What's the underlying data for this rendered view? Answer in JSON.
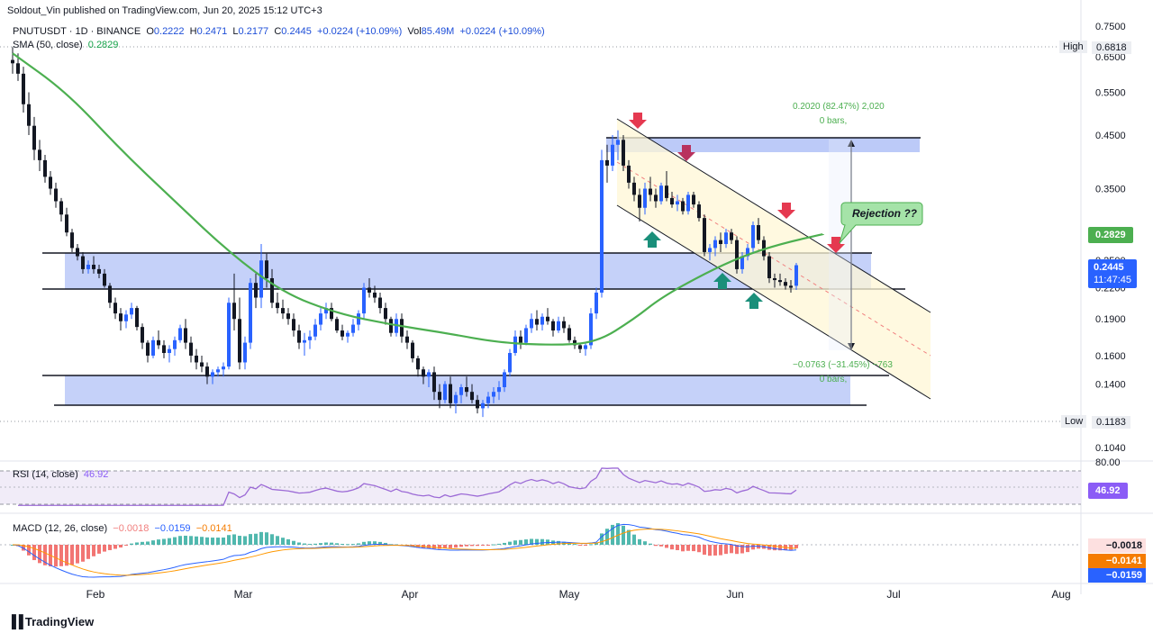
{
  "header": {
    "attribution": "Soldout_Vin published on TradingView.com, Jun 20, 2025 15:12 UTC+3"
  },
  "legend": {
    "symbol": "PNUTUSDT · 1D · BINANCE",
    "o_label": "O",
    "o": "0.2222",
    "h_label": "H",
    "h": "0.2471",
    "l_label": "L",
    "l": "0.2177",
    "c_label": "C",
    "c": "0.2445",
    "change": "+0.0224 (+10.09%)",
    "vol_label": "Vol",
    "vol": "85.49M",
    "vol_change": "+0.0224 (+10.09%)",
    "sma_label": "SMA (50, close)",
    "sma_value": "0.2829"
  },
  "price_axis": {
    "ticks": [
      "0.7500",
      "0.6500",
      "0.5500",
      "0.4500",
      "0.3500",
      "0.2800",
      "0.2500",
      "0.2200",
      "0.1900",
      "0.1600",
      "0.1400",
      "0.1040"
    ],
    "high_label": "High",
    "high_value": "0.6818",
    "low_label": "Low",
    "low_value": "0.1183",
    "sma_tag": "0.2829",
    "price_tag": "0.2445",
    "countdown": "11:47:45"
  },
  "time_axis": [
    "Feb",
    "Mar",
    "Apr",
    "May",
    "Jun",
    "Jul",
    "Aug"
  ],
  "annotations": {
    "rejection": "Rejection ??",
    "measure_up_line1": "0.2020 (82.47%) 2,020",
    "measure_up_line2": "0 bars,",
    "measure_down_line1": "−0.0763 (−31.45%) −763",
    "measure_down_line2": "0 bars,"
  },
  "rsi": {
    "label": "RSI (14, close)",
    "value": "46.92",
    "top_tick": "80.00",
    "tag": "46.92"
  },
  "macd": {
    "label": "MACD (12, 26, close)",
    "hist": "−0.0018",
    "macd": "−0.0159",
    "signal": "−0.0141",
    "tag_hist": "−0.0018",
    "tag_signal": "−0.0141",
    "tag_macd": "−0.0159"
  },
  "footer": {
    "brand": "TradingView"
  },
  "colors": {
    "up": "#2962ff",
    "down": "#131722",
    "sma": "#4caf50",
    "zone": "#9fb3f5",
    "rsi": "#9c6ad6",
    "macd_line": "#2962ff",
    "signal_line": "#ff9800",
    "hist_pos": "#26a69a",
    "hist_neg": "#ef5350",
    "arrow_down": "#e53950",
    "arrow_up": "#1a8f7a"
  },
  "chart_data": {
    "type": "candlestick",
    "symbol": "PNUTUSDT",
    "timeframe": "1D",
    "x_ticks": [
      "Feb",
      "Mar",
      "Apr",
      "May",
      "Jun",
      "Jul",
      "Aug"
    ],
    "y_ticks": [
      0.75,
      0.65,
      0.55,
      0.45,
      0.35,
      0.28,
      0.25,
      0.22,
      0.19,
      0.16,
      0.14,
      0.104
    ],
    "ohlc": [
      [
        0.64,
        0.68,
        0.6,
        0.63
      ],
      [
        0.63,
        0.66,
        0.58,
        0.6
      ],
      [
        0.6,
        0.62,
        0.5,
        0.52
      ],
      [
        0.52,
        0.55,
        0.45,
        0.47
      ],
      [
        0.47,
        0.49,
        0.4,
        0.42
      ],
      [
        0.42,
        0.44,
        0.38,
        0.4
      ],
      [
        0.4,
        0.41,
        0.36,
        0.37
      ],
      [
        0.37,
        0.38,
        0.34,
        0.35
      ],
      [
        0.35,
        0.36,
        0.32,
        0.33
      ],
      [
        0.33,
        0.335,
        0.3,
        0.31
      ],
      [
        0.31,
        0.32,
        0.28,
        0.285
      ],
      [
        0.285,
        0.29,
        0.26,
        0.265
      ],
      [
        0.265,
        0.27,
        0.25,
        0.255
      ],
      [
        0.255,
        0.26,
        0.235,
        0.24
      ],
      [
        0.24,
        0.25,
        0.235,
        0.245
      ],
      [
        0.245,
        0.255,
        0.235,
        0.24
      ],
      [
        0.24,
        0.245,
        0.23,
        0.235
      ],
      [
        0.235,
        0.24,
        0.22,
        0.222
      ],
      [
        0.222,
        0.225,
        0.2,
        0.205
      ],
      [
        0.205,
        0.21,
        0.19,
        0.195
      ],
      [
        0.195,
        0.2,
        0.18,
        0.188
      ],
      [
        0.188,
        0.198,
        0.182,
        0.194
      ],
      [
        0.194,
        0.205,
        0.19,
        0.2
      ],
      [
        0.2,
        0.202,
        0.18,
        0.183
      ],
      [
        0.183,
        0.186,
        0.165,
        0.17
      ],
      [
        0.17,
        0.172,
        0.155,
        0.16
      ],
      [
        0.16,
        0.175,
        0.158,
        0.172
      ],
      [
        0.172,
        0.18,
        0.165,
        0.168
      ],
      [
        0.168,
        0.172,
        0.158,
        0.162
      ],
      [
        0.162,
        0.168,
        0.155,
        0.165
      ],
      [
        0.165,
        0.175,
        0.16,
        0.172
      ],
      [
        0.172,
        0.185,
        0.17,
        0.182
      ],
      [
        0.182,
        0.19,
        0.165,
        0.17
      ],
      [
        0.17,
        0.175,
        0.155,
        0.16
      ],
      [
        0.16,
        0.165,
        0.15,
        0.155
      ],
      [
        0.155,
        0.16,
        0.148,
        0.152
      ],
      [
        0.152,
        0.155,
        0.14,
        0.145
      ],
      [
        0.145,
        0.15,
        0.14,
        0.148
      ],
      [
        0.148,
        0.152,
        0.145,
        0.15
      ],
      [
        0.15,
        0.155,
        0.145,
        0.152
      ],
      [
        0.152,
        0.21,
        0.15,
        0.205
      ],
      [
        0.205,
        0.235,
        0.18,
        0.19
      ],
      [
        0.19,
        0.21,
        0.15,
        0.155
      ],
      [
        0.155,
        0.175,
        0.15,
        0.17
      ],
      [
        0.17,
        0.23,
        0.165,
        0.225
      ],
      [
        0.225,
        0.235,
        0.2,
        0.21
      ],
      [
        0.21,
        0.27,
        0.2,
        0.25
      ],
      [
        0.25,
        0.258,
        0.22,
        0.23
      ],
      [
        0.23,
        0.24,
        0.2,
        0.205
      ],
      [
        0.205,
        0.215,
        0.195,
        0.2
      ],
      [
        0.2,
        0.208,
        0.19,
        0.195
      ],
      [
        0.195,
        0.2,
        0.185,
        0.19
      ],
      [
        0.19,
        0.195,
        0.175,
        0.18
      ],
      [
        0.18,
        0.185,
        0.165,
        0.17
      ],
      [
        0.17,
        0.178,
        0.16,
        0.172
      ],
      [
        0.172,
        0.18,
        0.165,
        0.175
      ],
      [
        0.175,
        0.19,
        0.172,
        0.185
      ],
      [
        0.185,
        0.2,
        0.18,
        0.195
      ],
      [
        0.195,
        0.205,
        0.19,
        0.2
      ],
      [
        0.2,
        0.205,
        0.188,
        0.19
      ],
      [
        0.19,
        0.192,
        0.178,
        0.18
      ],
      [
        0.18,
        0.185,
        0.172,
        0.175
      ],
      [
        0.175,
        0.18,
        0.17,
        0.178
      ],
      [
        0.178,
        0.19,
        0.175,
        0.185
      ],
      [
        0.185,
        0.198,
        0.18,
        0.195
      ],
      [
        0.195,
        0.225,
        0.19,
        0.22
      ],
      [
        0.22,
        0.23,
        0.21,
        0.215
      ],
      [
        0.215,
        0.222,
        0.205,
        0.21
      ],
      [
        0.21,
        0.215,
        0.195,
        0.2
      ],
      [
        0.2,
        0.205,
        0.185,
        0.19
      ],
      [
        0.19,
        0.192,
        0.175,
        0.178
      ],
      [
        0.178,
        0.195,
        0.175,
        0.19
      ],
      [
        0.19,
        0.195,
        0.17,
        0.175
      ],
      [
        0.175,
        0.18,
        0.165,
        0.17
      ],
      [
        0.17,
        0.172,
        0.155,
        0.158
      ],
      [
        0.158,
        0.16,
        0.145,
        0.15
      ],
      [
        0.15,
        0.152,
        0.14,
        0.145
      ],
      [
        0.145,
        0.15,
        0.138,
        0.148
      ],
      [
        0.148,
        0.152,
        0.13,
        0.135
      ],
      [
        0.135,
        0.14,
        0.125,
        0.13
      ],
      [
        0.13,
        0.142,
        0.128,
        0.14
      ],
      [
        0.14,
        0.145,
        0.125,
        0.128
      ],
      [
        0.128,
        0.135,
        0.122,
        0.133
      ],
      [
        0.133,
        0.14,
        0.128,
        0.138
      ],
      [
        0.138,
        0.145,
        0.132,
        0.135
      ],
      [
        0.135,
        0.14,
        0.128,
        0.13
      ],
      [
        0.13,
        0.133,
        0.122,
        0.125
      ],
      [
        0.125,
        0.13,
        0.12,
        0.128
      ],
      [
        0.128,
        0.135,
        0.125,
        0.132
      ],
      [
        0.132,
        0.138,
        0.128,
        0.135
      ],
      [
        0.135,
        0.142,
        0.13,
        0.138
      ],
      [
        0.138,
        0.15,
        0.135,
        0.148
      ],
      [
        0.148,
        0.165,
        0.145,
        0.162
      ],
      [
        0.162,
        0.18,
        0.16,
        0.175
      ],
      [
        0.175,
        0.18,
        0.165,
        0.17
      ],
      [
        0.17,
        0.185,
        0.168,
        0.182
      ],
      [
        0.182,
        0.195,
        0.178,
        0.19
      ],
      [
        0.19,
        0.198,
        0.18,
        0.185
      ],
      [
        0.185,
        0.195,
        0.18,
        0.192
      ],
      [
        0.192,
        0.2,
        0.185,
        0.188
      ],
      [
        0.188,
        0.19,
        0.175,
        0.18
      ],
      [
        0.18,
        0.192,
        0.178,
        0.188
      ],
      [
        0.188,
        0.192,
        0.178,
        0.182
      ],
      [
        0.182,
        0.185,
        0.17,
        0.172
      ],
      [
        0.172,
        0.175,
        0.165,
        0.168
      ],
      [
        0.168,
        0.17,
        0.162,
        0.165
      ],
      [
        0.165,
        0.17,
        0.16,
        0.168
      ],
      [
        0.168,
        0.2,
        0.165,
        0.195
      ],
      [
        0.195,
        0.22,
        0.19,
        0.215
      ],
      [
        0.215,
        0.42,
        0.21,
        0.4
      ],
      [
        0.4,
        0.43,
        0.36,
        0.39
      ],
      [
        0.39,
        0.45,
        0.38,
        0.43
      ],
      [
        0.43,
        0.46,
        0.4,
        0.44
      ],
      [
        0.44,
        0.45,
        0.38,
        0.39
      ],
      [
        0.39,
        0.4,
        0.35,
        0.36
      ],
      [
        0.36,
        0.37,
        0.33,
        0.34
      ],
      [
        0.34,
        0.35,
        0.3,
        0.32
      ],
      [
        0.32,
        0.36,
        0.31,
        0.35
      ],
      [
        0.35,
        0.37,
        0.33,
        0.34
      ],
      [
        0.34,
        0.35,
        0.32,
        0.33
      ],
      [
        0.33,
        0.36,
        0.325,
        0.355
      ],
      [
        0.355,
        0.38,
        0.33,
        0.335
      ],
      [
        0.335,
        0.345,
        0.32,
        0.325
      ],
      [
        0.325,
        0.34,
        0.315,
        0.33
      ],
      [
        0.33,
        0.335,
        0.31,
        0.315
      ],
      [
        0.315,
        0.345,
        0.31,
        0.34
      ],
      [
        0.34,
        0.345,
        0.32,
        0.325
      ],
      [
        0.325,
        0.33,
        0.3,
        0.305
      ],
      [
        0.305,
        0.31,
        0.255,
        0.26
      ],
      [
        0.26,
        0.27,
        0.25,
        0.265
      ],
      [
        0.265,
        0.28,
        0.255,
        0.275
      ],
      [
        0.275,
        0.285,
        0.26,
        0.27
      ],
      [
        0.27,
        0.29,
        0.265,
        0.285
      ],
      [
        0.285,
        0.29,
        0.27,
        0.275
      ],
      [
        0.275,
        0.28,
        0.235,
        0.24
      ],
      [
        0.24,
        0.26,
        0.235,
        0.255
      ],
      [
        0.255,
        0.27,
        0.25,
        0.265
      ],
      [
        0.265,
        0.3,
        0.26,
        0.295
      ],
      [
        0.295,
        0.305,
        0.27,
        0.275
      ],
      [
        0.275,
        0.28,
        0.25,
        0.255
      ],
      [
        0.255,
        0.26,
        0.225,
        0.23
      ],
      [
        0.23,
        0.235,
        0.22,
        0.228
      ],
      [
        0.228,
        0.235,
        0.222,
        0.226
      ],
      [
        0.226,
        0.23,
        0.218,
        0.222
      ],
      [
        0.222,
        0.228,
        0.215,
        0.22
      ],
      [
        0.222,
        0.2471,
        0.2177,
        0.2445
      ]
    ],
    "sma_50": [
      [
        0,
        0.66
      ],
      [
        10,
        0.55
      ],
      [
        20,
        0.42
      ],
      [
        30,
        0.33
      ],
      [
        40,
        0.26
      ],
      [
        50,
        0.215
      ],
      [
        60,
        0.195
      ],
      [
        70,
        0.185
      ],
      [
        80,
        0.178
      ],
      [
        90,
        0.17
      ],
      [
        100,
        0.168
      ],
      [
        108,
        0.17
      ],
      [
        115,
        0.19
      ],
      [
        120,
        0.21
      ],
      [
        128,
        0.235
      ],
      [
        135,
        0.255
      ],
      [
        142,
        0.27
      ],
      [
        150,
        0.2829
      ]
    ],
    "zones": [
      {
        "name": "resistance-zone",
        "from": 0.415,
        "to": 0.45
      },
      {
        "name": "mid-zone",
        "from": 0.22,
        "to": 0.26
      },
      {
        "name": "support-zone",
        "from": 0.125,
        "to": 0.145
      }
    ],
    "rsi_range": [
      20,
      80
    ],
    "rsi_last": 46.92,
    "macd_last": {
      "macd": -0.0159,
      "signal": -0.0141,
      "hist": -0.0018
    }
  }
}
